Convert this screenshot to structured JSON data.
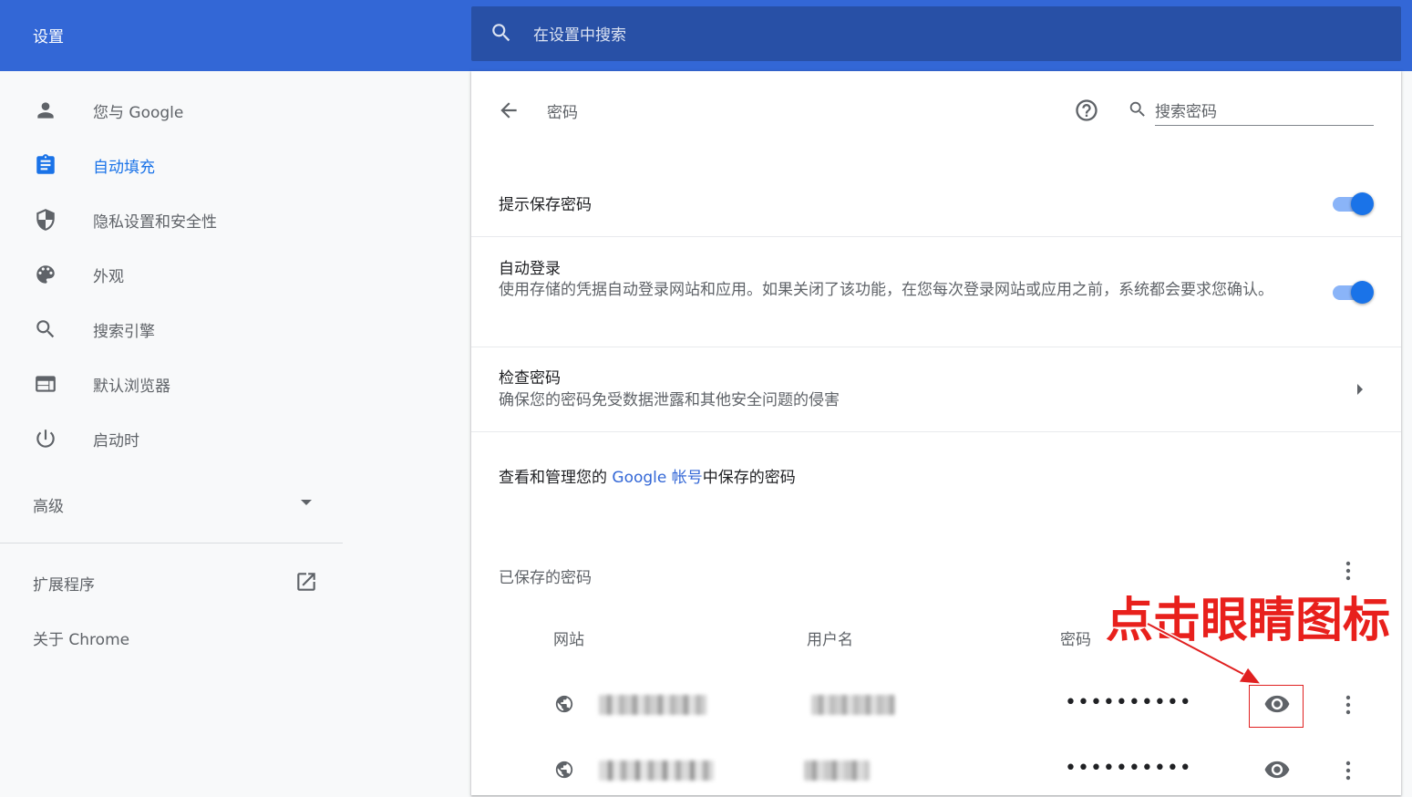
{
  "header": {
    "app_title": "设置",
    "search_placeholder": "在设置中搜索"
  },
  "sidebar": {
    "items": [
      {
        "label": "您与 Google",
        "icon": "person-icon"
      },
      {
        "label": "自动填充",
        "icon": "clipboard-icon",
        "active": true
      },
      {
        "label": "隐私设置和安全性",
        "icon": "shield-icon"
      },
      {
        "label": "外观",
        "icon": "palette-icon"
      },
      {
        "label": "搜索引擎",
        "icon": "search-icon"
      },
      {
        "label": "默认浏览器",
        "icon": "browser-window-icon"
      },
      {
        "label": "启动时",
        "icon": "power-icon"
      }
    ],
    "advanced_label": "高级",
    "extensions_label": "扩展程序",
    "about_label": "关于 Chrome"
  },
  "main": {
    "page_title": "密码",
    "search_placeholder": "搜索密码",
    "offer_save": {
      "title": "提示保存密码",
      "enabled": true
    },
    "auto_signin": {
      "title": "自动登录",
      "description": "使用存储的凭据自动登录网站和应用。如果关闭了该功能，在您每次登录网站或应用之前，系统都会要求您确认。",
      "enabled": true
    },
    "check_passwords": {
      "title": "检查密码",
      "description": "确保您的密码免受数据泄露和其他安全问题的侵害"
    },
    "google_account": {
      "prefix": "查看和管理您的 ",
      "link": "Google 帐号",
      "suffix": "中保存的密码"
    },
    "saved_passwords": {
      "title": "已保存的密码",
      "columns": [
        "网站",
        "用户名",
        "密码"
      ],
      "rows": [
        {
          "password_mask": "••••••••••"
        },
        {
          "password_mask": "••••••••••"
        }
      ]
    }
  },
  "annotation": {
    "text": "点击眼睛图标",
    "color": "#e8201c"
  },
  "colors": {
    "header": "#3367d6",
    "accent": "#1a73e8",
    "toggle_track": "#8ab4f8"
  }
}
